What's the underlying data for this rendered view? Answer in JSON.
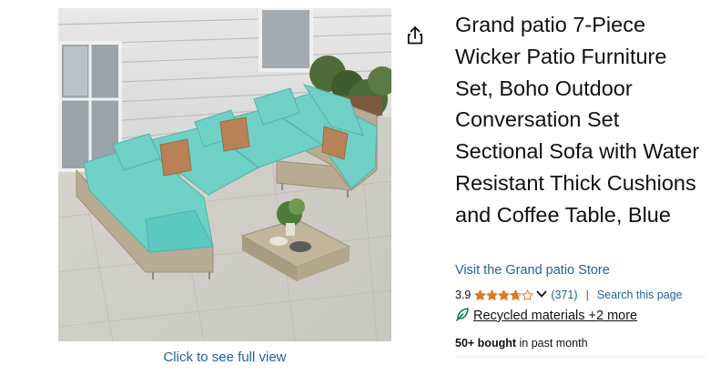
{
  "product": {
    "title": "Grand patio 7-Piece Wicker Patio Furniture Set, Boho Outdoor Conversation Set Sectional Sofa with Water Resistant Thick Cushions and Coffee Table, Blue",
    "store_link": "Visit the Grand patio Store",
    "rating": {
      "value": "3.9",
      "stars_filled": 3.9,
      "stars_max": 5,
      "count_label": "(371)",
      "divider": "|",
      "search_label": "Search this page"
    },
    "badge": {
      "icon": "leaf-icon",
      "label": "Recycled materials +2 more"
    },
    "bought": {
      "bold": "50+ bought",
      "rest": " in past month"
    }
  },
  "gallery": {
    "full_view_label": "Click to see full view",
    "share_icon": "share-icon"
  },
  "colors": {
    "link": "#2162a1",
    "star": "#de7921",
    "text": "#0f1111",
    "badge_green": "#067d62",
    "cushion": "#5cc9c0"
  }
}
